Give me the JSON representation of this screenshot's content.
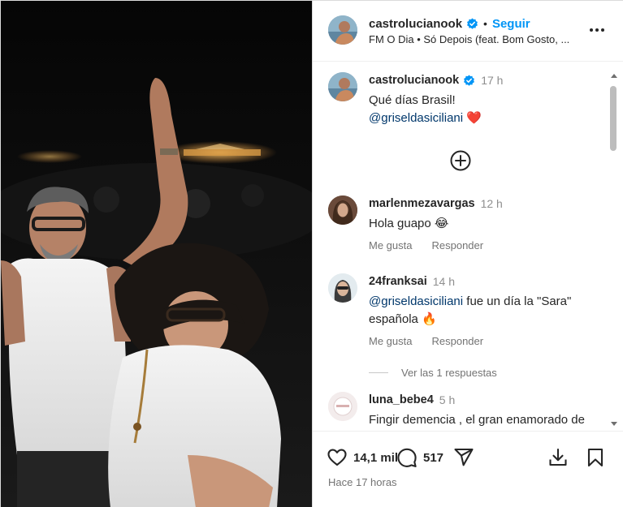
{
  "post": {
    "username": "castrolucianook",
    "follow_label": "Seguir",
    "separator": "•",
    "audio": "FM O Dia • Só Depois (feat. Bom Gosto, ...",
    "more_icon": "more-horizontal-icon",
    "verified_color": "#0095f6"
  },
  "caption": {
    "username": "castrolucianook",
    "time": "17 h",
    "text_line1": "Qué días Brasil!",
    "mention": "@griseldasiciliani",
    "emoji": "❤️"
  },
  "add_comment_icon": "plus-circle-icon",
  "comments": [
    {
      "username": "marlenmezavargas",
      "time": "12 h",
      "text": "Hola guapo 😂",
      "like_label": "Me gusta",
      "reply_label": "Responder"
    },
    {
      "username": "24franksai",
      "time": "14 h",
      "mention": "@griseldasiciliani",
      "text_after_mention": " fue un día la \"Sara\" española 🔥",
      "like_label": "Me gusta",
      "reply_label": "Responder"
    },
    {
      "username": "luna_bebe4",
      "time": "5 h",
      "text": "Fingir demencia , el gran enamorado de Gri jaaaaa"
    }
  ],
  "view_replies": "Ver las 1 respuestas",
  "stats": {
    "likes": "14,1 mil",
    "comments": "517"
  },
  "posted_ago": "Hace 17 horas",
  "colors": {
    "accent": "#0095f6",
    "mention": "#00376b",
    "heart": "#ed4956"
  }
}
